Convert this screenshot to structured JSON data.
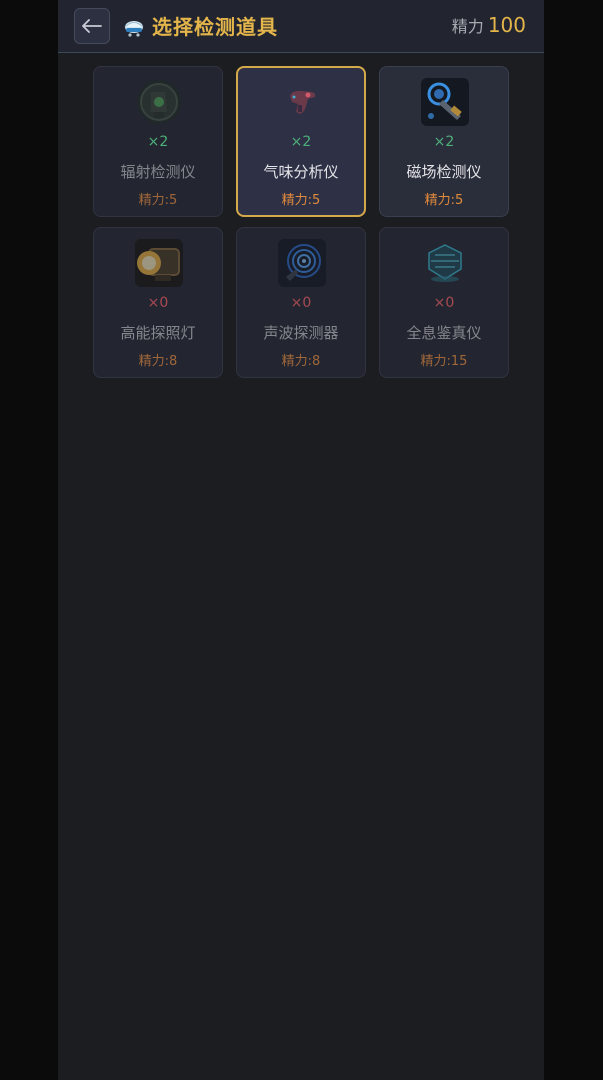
{
  "header": {
    "title": "选择检测道具",
    "energy_label": "精力",
    "energy_value": "100"
  },
  "tools": [
    {
      "count": "×2",
      "name": "辐射检测仪",
      "cost": "精力:5",
      "icon": "radiation-detector-icon",
      "state": "dim"
    },
    {
      "count": "×2",
      "name": "气味分析仪",
      "cost": "精力:5",
      "icon": "odor-analyzer-icon",
      "state": "selected"
    },
    {
      "count": "×2",
      "name": "磁场检测仪",
      "cost": "精力:5",
      "icon": "magnetic-detector-icon",
      "state": "available"
    },
    {
      "count": "×0",
      "name": "高能探照灯",
      "cost": "精力:8",
      "icon": "searchlight-icon",
      "state": "dim"
    },
    {
      "count": "×0",
      "name": "声波探测器",
      "cost": "精力:8",
      "icon": "sonar-detector-icon",
      "state": "dim"
    },
    {
      "count": "×0",
      "name": "全息鉴真仪",
      "cost": "精力:15",
      "icon": "hologram-verifier-icon",
      "state": "dim"
    }
  ],
  "colors": {
    "accent": "#e4b54a",
    "count_available": "#4db07a",
    "count_empty": "#a94a52",
    "cost": "#e08a3c"
  }
}
